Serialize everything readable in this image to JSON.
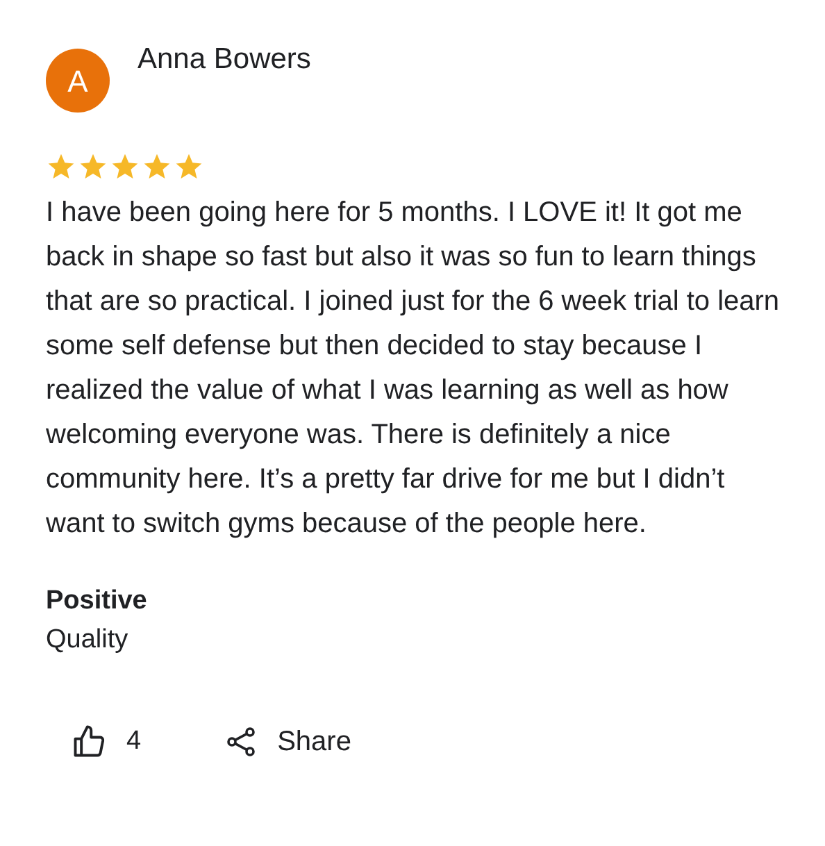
{
  "review": {
    "avatar_letter": "A",
    "author": "Anna Bowers",
    "stars": 5,
    "text": "I have been going here for 5 months. I LOVE it! It got me back in shape so fast but also it was so fun to learn things that are so practical. I joined just for the 6 week trial to learn some self defense but then decided to stay because I realized the value of what I was learning as well as how welcoming everyone was. There is definitely a nice community here. It’s a pretty far drive for me but I didn’t want to switch gyms because of the people here.",
    "highlights": [
      {
        "heading": "Positive",
        "value": "Quality"
      }
    ],
    "likes": "4",
    "share_label": "Share"
  }
}
